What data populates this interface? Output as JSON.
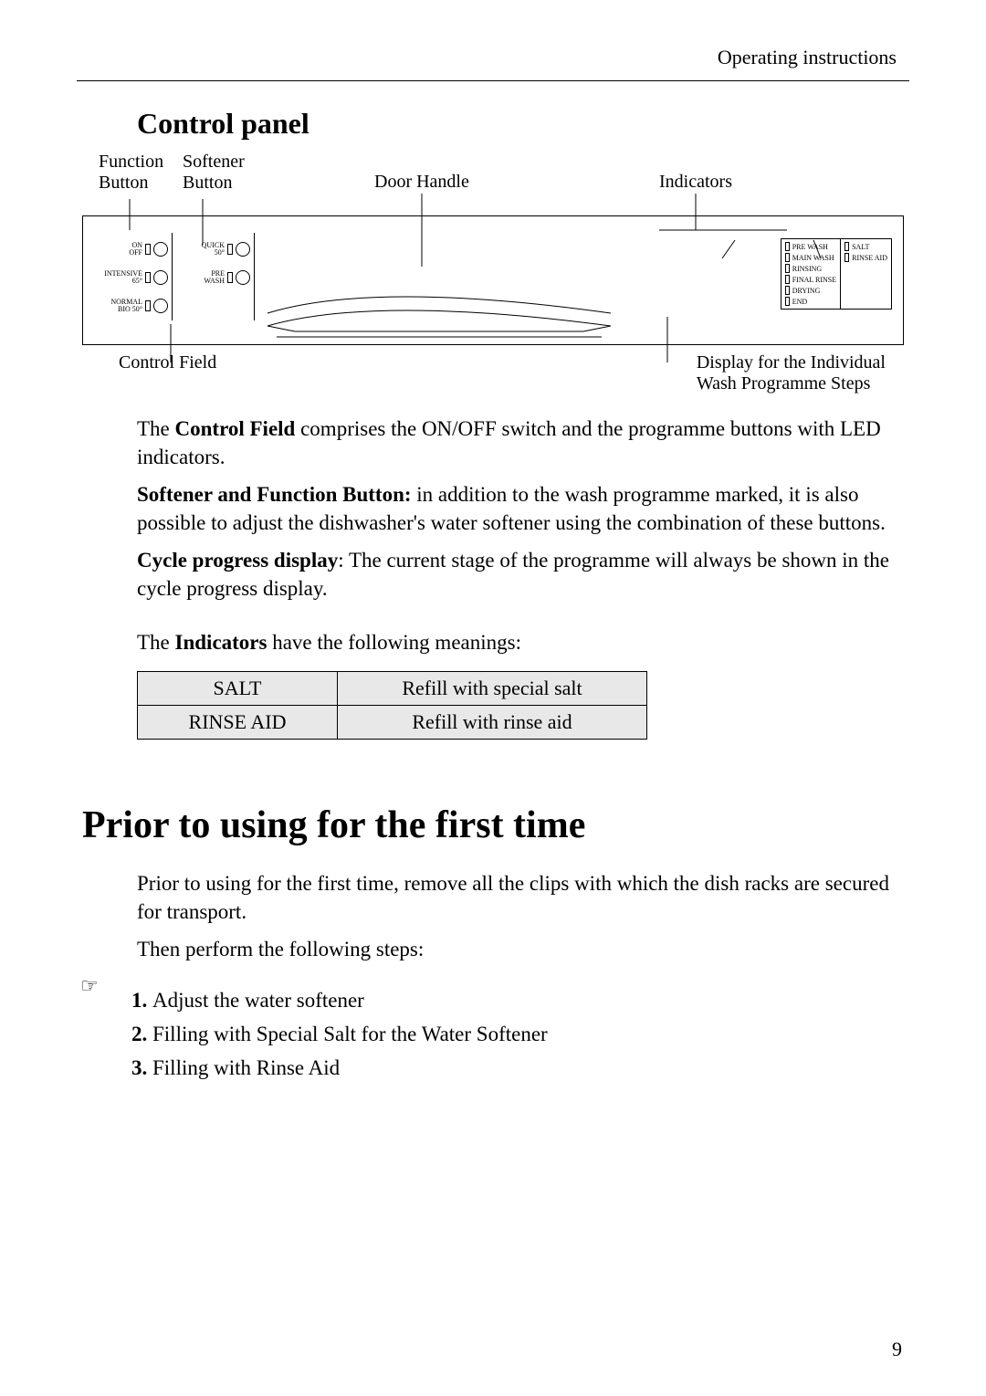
{
  "header": "Operating instructions",
  "section_title": "Control panel",
  "top_labels": {
    "func1": "Function",
    "func2": "Button",
    "soft1": "Softener",
    "soft2": "Button",
    "door": "Door Handle",
    "ind": "Indicators"
  },
  "control_left": [
    {
      "l1": "ON",
      "l2": "OFF"
    },
    {
      "l1": "INTENSIVE",
      "l2": "65°"
    },
    {
      "l1": "NORMAL",
      "l2": "BIO 50°"
    }
  ],
  "control_right": [
    {
      "l1": "QUICK",
      "l2": "50°"
    },
    {
      "l1": "PRE",
      "l2": "WASH"
    }
  ],
  "ind_left": [
    "PRE WASH",
    "MAIN WASH",
    "RINSING",
    "FINAL RINSE",
    "DRYING",
    "END"
  ],
  "ind_right": [
    "SALT",
    "RINSE AID"
  ],
  "bottom_labels": {
    "left": "Control Field",
    "right1": "Display for the Individual",
    "right2": "Wash Programme Steps"
  },
  "para1_pre": "The ",
  "para1_bold": "Control Field",
  "para1_post": " comprises the ON/OFF switch and the programme buttons with LED indicators.",
  "para2_bold": "Softener and Function Button:",
  "para2_post": " in addition to the wash programme marked, it is also possible to adjust the dishwasher's water softener using the combination of these buttons.",
  "para3_bold": "Cycle progress display",
  "para3_post": ": The current stage of the programme will always be shown in the cycle progress display.",
  "para4_pre": "The ",
  "para4_bold": "Indicators",
  "para4_post": " have the following meanings:",
  "table": [
    {
      "l": "SALT",
      "r": "Refill with special salt"
    },
    {
      "l": "RINSE AID",
      "r": "Refill with rinse aid"
    }
  ],
  "h1": "Prior to using for the first time",
  "intro1": "Prior to using for the first time, remove all the clips with which the dish racks are secured for transport.",
  "intro2": "Then perform the following steps:",
  "steps": [
    "Adjust the water softener",
    "Filling with Special Salt for the Water Softener",
    "Filling with Rinse Aid"
  ],
  "page_num": "9"
}
